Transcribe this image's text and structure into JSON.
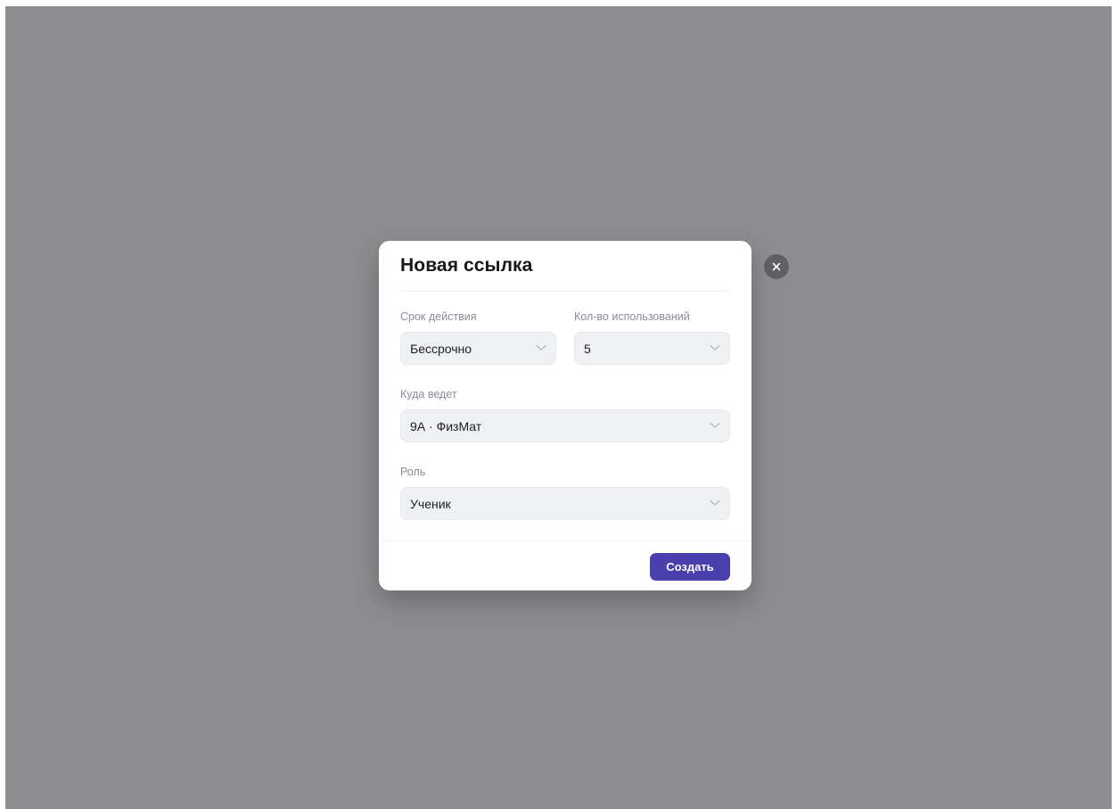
{
  "modal": {
    "title": "Новая ссылка",
    "fields": {
      "validity": {
        "label": "Срок действия",
        "value": "Бессрочно"
      },
      "uses": {
        "label": "Кол-во использований",
        "value": "5"
      },
      "target": {
        "label": "Куда ведет",
        "value": "9А · ФизМат"
      },
      "role": {
        "label": "Роль",
        "value": "Ученик"
      }
    },
    "create_label": "Создать"
  },
  "icons": {
    "close": "close-icon",
    "dropdown": "chevron-down-icon"
  },
  "colors": {
    "overlay": "#8e8e91",
    "accent": "#4b3fae",
    "close_button": "#5f5f64"
  }
}
